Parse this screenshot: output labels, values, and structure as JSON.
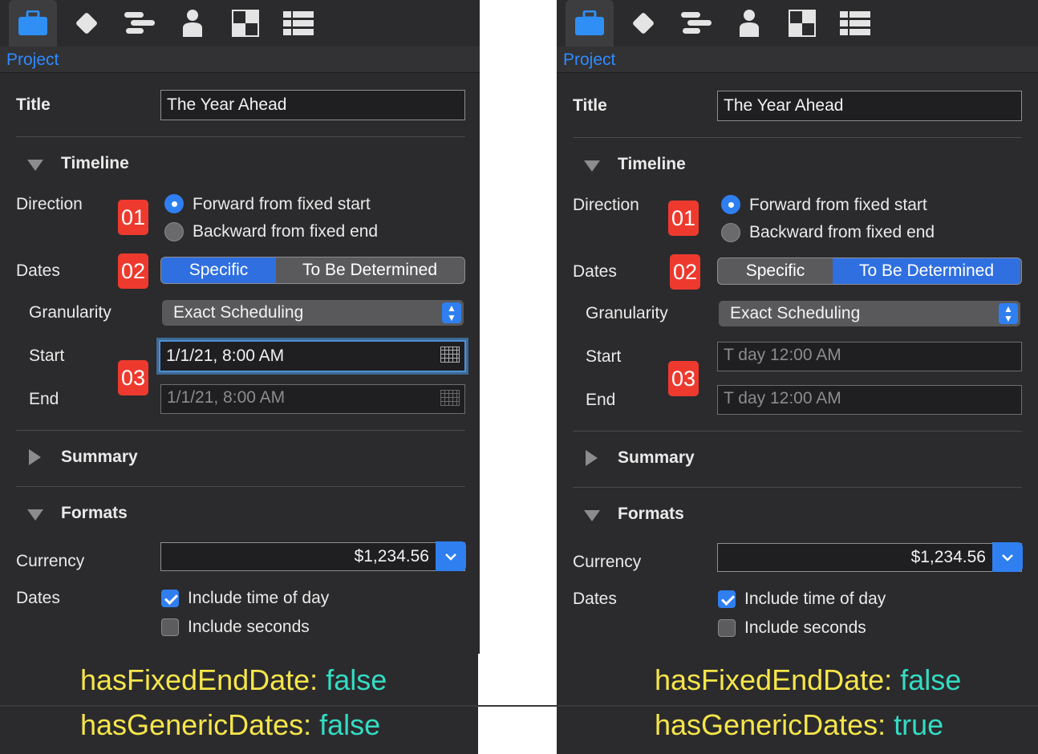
{
  "colors": {
    "accent": "#2f7ff0",
    "badge": "#ee3a2e",
    "key": "#f6e54b",
    "value": "#33dcc3",
    "panel": "#2b2b2d"
  },
  "toolbar_icons": [
    "briefcase-icon",
    "diamond-icon",
    "gantt-icon",
    "person-icon",
    "checkerboard-icon",
    "table-icon"
  ],
  "panels": [
    {
      "breadcrumb": "Project",
      "title_label": "Title",
      "title_value": "The Year Ahead",
      "timeline_heading": "Timeline",
      "direction_label": "Direction",
      "badge1": "01",
      "radio_forward": "Forward from fixed start",
      "radio_backward": "Backward from fixed end",
      "direction_selected": "forward",
      "dates_label": "Dates",
      "badge2": "02",
      "seg_specific": "Specific",
      "seg_tbd": "To Be Determined",
      "dates_selected": "Specific",
      "granularity_label": "Granularity",
      "granularity_value": "Exact Scheduling",
      "start_label": "Start",
      "end_label": "End",
      "badge3": "03",
      "start_value": "1/1/21, 8:00 AM",
      "end_value": "1/1/21, 8:00 AM",
      "summary_heading": "Summary",
      "formats_heading": "Formats",
      "currency_label": "Currency",
      "currency_value": "$1,234.56",
      "dates_format_label": "Dates",
      "include_time": "Include time of day",
      "include_time_checked": true,
      "include_seconds": "Include seconds",
      "include_seconds_checked": false,
      "status1_key": "hasFixedEndDate:",
      "status1_value": "false",
      "status2_key": "hasGenericDates:",
      "status2_value": "false"
    },
    {
      "breadcrumb": "Project",
      "title_label": "Title",
      "title_value": "The Year Ahead",
      "timeline_heading": "Timeline",
      "direction_label": "Direction",
      "badge1": "01",
      "radio_forward": "Forward from fixed start",
      "radio_backward": "Backward from fixed end",
      "direction_selected": "forward",
      "dates_label": "Dates",
      "badge2": "02",
      "seg_specific": "Specific",
      "seg_tbd": "To Be Determined",
      "dates_selected": "To Be Determined",
      "granularity_label": "Granularity",
      "granularity_value": "Exact Scheduling",
      "start_label": "Start",
      "end_label": "End",
      "badge3": "03",
      "start_value": "T day 12:00 AM",
      "end_value": "T day 12:00 AM",
      "summary_heading": "Summary",
      "formats_heading": "Formats",
      "currency_label": "Currency",
      "currency_value": "$1,234.56",
      "dates_format_label": "Dates",
      "include_time": "Include time of day",
      "include_time_checked": true,
      "include_seconds": "Include seconds",
      "include_seconds_checked": false,
      "status1_key": "hasFixedEndDate:",
      "status1_value": "false",
      "status2_key": "hasGenericDates:",
      "status2_value": "true"
    }
  ]
}
